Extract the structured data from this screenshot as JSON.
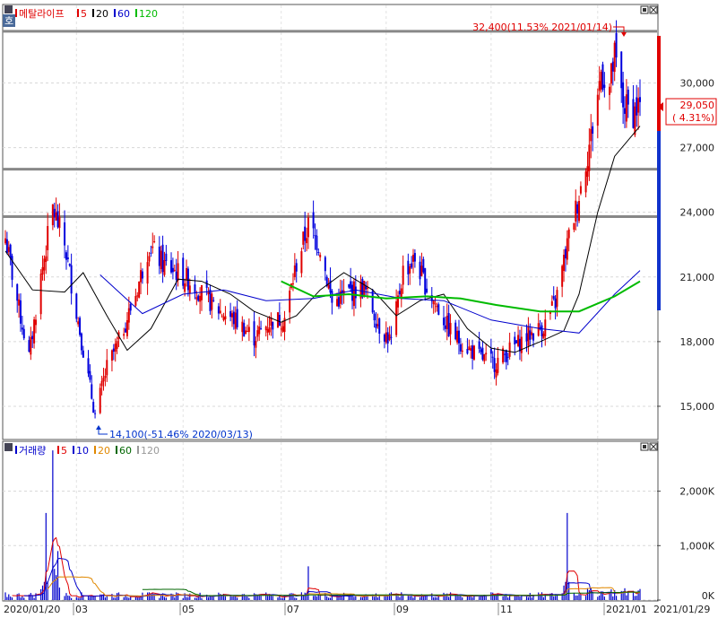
{
  "price_panel": {
    "title": "메탈라이프",
    "icon_label": "호",
    "ma_legend": [
      {
        "label": "5",
        "color": "#e00000"
      },
      {
        "label": "20",
        "color": "#000000"
      },
      {
        "label": "60",
        "color": "#0000cc"
      },
      {
        "label": "120",
        "color": "#00bb00"
      }
    ],
    "current_price": "29,050",
    "current_change": "( 4.31%)",
    "high_annotation": "32,400(11.53% 2021/01/14)",
    "low_annotation": "14,100(-51.46% 2020/03/13)"
  },
  "volume_panel": {
    "title": "거래량",
    "ma_legend": [
      {
        "label": "5",
        "color": "#e00000"
      },
      {
        "label": "10",
        "color": "#0000cc"
      },
      {
        "label": "20",
        "color": "#e08800"
      },
      {
        "label": "60",
        "color": "#006600"
      },
      {
        "label": "120",
        "color": "#999999"
      }
    ]
  },
  "x_axis": {
    "labels": [
      "2020/01/20",
      "03",
      "05",
      "07",
      "09",
      "11",
      "2021/01",
      "2021/01/29"
    ]
  },
  "chart_data": [
    {
      "type": "candlestick",
      "title": "메탈라이프",
      "x_range": [
        "2020/01/20",
        "2021/01/29"
      ],
      "ylim": [
        13500,
        33600
      ],
      "y_ticks": [
        15000,
        18000,
        21000,
        24000,
        27000,
        30000
      ],
      "y_tick_labels": [
        "15,000",
        "18,000",
        "21,000",
        "24,000",
        "27,000",
        "30,000"
      ],
      "horizontal_lines": [
        32400,
        26000,
        23800
      ],
      "last_close": 29050,
      "high": {
        "value": 32400,
        "date": "2021/01/14"
      },
      "low": {
        "value": 14100,
        "date": "2020/03/13"
      },
      "close_path": [
        [
          "2020/01/20",
          22800
        ],
        [
          "2020/01/28",
          19500
        ],
        [
          "2020/02/03",
          17300
        ],
        [
          "2020/02/10",
          21000
        ],
        [
          "2020/02/17",
          24200
        ],
        [
          "2020/02/24",
          22500
        ],
        [
          "2020/03/02",
          19400
        ],
        [
          "2020/03/06",
          17600
        ],
        [
          "2020/03/13",
          14600
        ],
        [
          "2020/03/20",
          16800
        ],
        [
          "2020/03/27",
          18000
        ],
        [
          "2020/04/06",
          20200
        ],
        [
          "2020/04/14",
          22500
        ],
        [
          "2020/04/22",
          21600
        ],
        [
          "2020/04/29",
          21300
        ],
        [
          "2020/05/08",
          20800
        ],
        [
          "2020/05/18",
          20000
        ],
        [
          "2020/05/26",
          19400
        ],
        [
          "2020/06/04",
          19000
        ],
        [
          "2020/06/15",
          18200
        ],
        [
          "2020/06/24",
          18900
        ],
        [
          "2020/07/03",
          19100
        ],
        [
          "2020/07/10",
          21600
        ],
        [
          "2020/07/17",
          23400
        ],
        [
          "2020/07/24",
          22400
        ],
        [
          "2020/07/31",
          19800
        ],
        [
          "2020/08/10",
          20300
        ],
        [
          "2020/08/19",
          20500
        ],
        [
          "2020/08/28",
          18700
        ],
        [
          "2020/09/04",
          18000
        ],
        [
          "2020/09/11",
          21300
        ],
        [
          "2020/09/18",
          21800
        ],
        [
          "2020/09/25",
          20500
        ],
        [
          "2020/10/08",
          18600
        ],
        [
          "2020/10/16",
          17900
        ],
        [
          "2020/10/26",
          17300
        ],
        [
          "2020/11/04",
          17000
        ],
        [
          "2020/11/13",
          17600
        ],
        [
          "2020/11/24",
          18300
        ],
        [
          "2020/12/03",
          18700
        ],
        [
          "2020/12/10",
          19800
        ],
        [
          "2020/12/17",
          22500
        ],
        [
          "2020/12/24",
          24800
        ],
        [
          "2020/12/31",
          27500
        ],
        [
          "2021/01/06",
          30500
        ],
        [
          "2021/01/11",
          29800
        ],
        [
          "2021/01/14",
          31200
        ],
        [
          "2021/01/19",
          29000
        ],
        [
          "2021/01/25",
          28600
        ],
        [
          "2021/01/29",
          29050
        ]
      ],
      "ma_lines": [
        {
          "name": "20",
          "color": "#000000",
          "points": [
            [
              "2020/01/20",
              22200
            ],
            [
              "2020/02/05",
              20400
            ],
            [
              "2020/02/24",
              20300
            ],
            [
              "2020/03/06",
              21200
            ],
            [
              "2020/03/20",
              19200
            ],
            [
              "2020/04/01",
              17600
            ],
            [
              "2020/04/15",
              18600
            ],
            [
              "2020/05/01",
              20900
            ],
            [
              "2020/05/15",
              20800
            ],
            [
              "2020/06/01",
              20200
            ],
            [
              "2020/06/15",
              19400
            ],
            [
              "2020/07/01",
              18900
            ],
            [
              "2020/07/10",
              19200
            ],
            [
              "2020/07/24",
              20400
            ],
            [
              "2020/08/07",
              21200
            ],
            [
              "2020/08/24",
              20400
            ],
            [
              "2020/09/07",
              19200
            ],
            [
              "2020/09/21",
              19900
            ],
            [
              "2020/10/05",
              20200
            ],
            [
              "2020/10/19",
              18600
            ],
            [
              "2020/11/02",
              17700
            ],
            [
              "2020/11/16",
              17500
            ],
            [
              "2020/12/01",
              18000
            ],
            [
              "2020/12/15",
              18500
            ],
            [
              "2020/12/24",
              20200
            ],
            [
              "2021/01/04",
              24000
            ],
            [
              "2021/01/14",
              26600
            ],
            [
              "2021/01/29",
              28000
            ]
          ]
        },
        {
          "name": "60",
          "color": "#0000cc",
          "points": [
            [
              "2020/03/16",
              21100
            ],
            [
              "2020/04/10",
              19300
            ],
            [
              "2020/05/04",
              20200
            ],
            [
              "2020/05/28",
              20400
            ],
            [
              "2020/06/22",
              19900
            ],
            [
              "2020/07/20",
              20000
            ],
            [
              "2020/08/14",
              20400
            ],
            [
              "2020/09/10",
              20000
            ],
            [
              "2020/10/05",
              19900
            ],
            [
              "2020/11/02",
              19000
            ],
            [
              "2020/12/01",
              18600
            ],
            [
              "2020/12/24",
              18400
            ],
            [
              "2021/01/14",
              20200
            ],
            [
              "2021/01/29",
              21300
            ]
          ]
        },
        {
          "name": "120",
          "color": "#00bb00",
          "points": [
            [
              "2020/07/01",
              20800
            ],
            [
              "2020/07/20",
              20100
            ],
            [
              "2020/08/10",
              20200
            ],
            [
              "2020/09/01",
              20000
            ],
            [
              "2020/09/25",
              20100
            ],
            [
              "2020/10/15",
              20000
            ],
            [
              "2020/11/05",
              19700
            ],
            [
              "2020/12/01",
              19400
            ],
            [
              "2020/12/24",
              19400
            ],
            [
              "2021/01/14",
              20100
            ],
            [
              "2021/01/29",
              20800
            ]
          ]
        }
      ]
    },
    {
      "type": "bar",
      "title": "거래량",
      "ylim": [
        0,
        2900000
      ],
      "y_ticks": [
        0,
        1000000,
        2000000
      ],
      "y_tick_labels": [
        "0K",
        "1,000K",
        "2,000K"
      ],
      "spikes": [
        {
          "date": "2020/02/13",
          "value": 1600000
        },
        {
          "date": "2020/02/17",
          "value": 2750000
        },
        {
          "date": "2020/02/20",
          "value": 900000
        },
        {
          "date": "2020/07/17",
          "value": 620000
        },
        {
          "date": "2020/12/17",
          "value": 1000000
        }
      ],
      "base_volume": 90000
    }
  ]
}
